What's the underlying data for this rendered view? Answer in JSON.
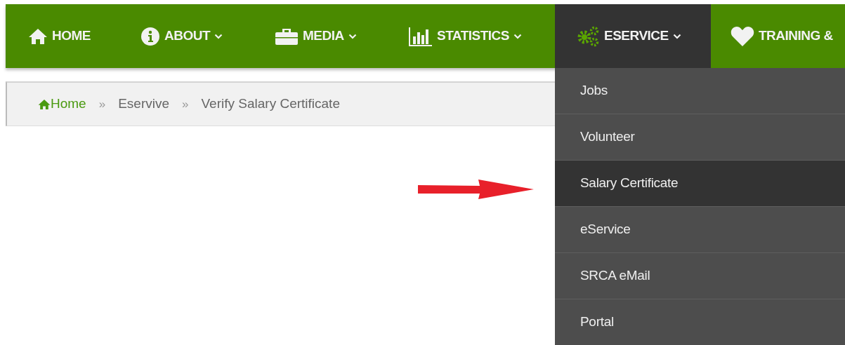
{
  "nav": {
    "items": [
      {
        "label": "HOME",
        "kind": "home",
        "caret": false,
        "selected": false
      },
      {
        "label": "ABOUT",
        "kind": "info",
        "caret": true,
        "selected": false
      },
      {
        "label": "MEDIA",
        "kind": "briefcase",
        "caret": true,
        "selected": false
      },
      {
        "label": "STATISTICS",
        "kind": "chart",
        "caret": true,
        "selected": false
      },
      {
        "label": "ESERVICE",
        "kind": "gears",
        "caret": true,
        "selected": true
      },
      {
        "label": "TRAINING &",
        "kind": "heart",
        "caret": false,
        "selected": false
      }
    ]
  },
  "breadcrumb": [
    {
      "label": "Home",
      "kind": "home"
    },
    {
      "label": "Eservive",
      "kind": "link"
    },
    {
      "label": "Verify Salary Certificate",
      "kind": "current"
    }
  ],
  "separator": "»",
  "dropdown": {
    "items": [
      {
        "label": "Jobs",
        "selected": false
      },
      {
        "label": "Volunteer",
        "selected": false
      },
      {
        "label": "Salary Certificate",
        "selected": true
      },
      {
        "label": "eService",
        "selected": false
      },
      {
        "label": "SRCA eMail",
        "selected": false
      },
      {
        "label": "Portal",
        "selected": false
      }
    ]
  }
}
